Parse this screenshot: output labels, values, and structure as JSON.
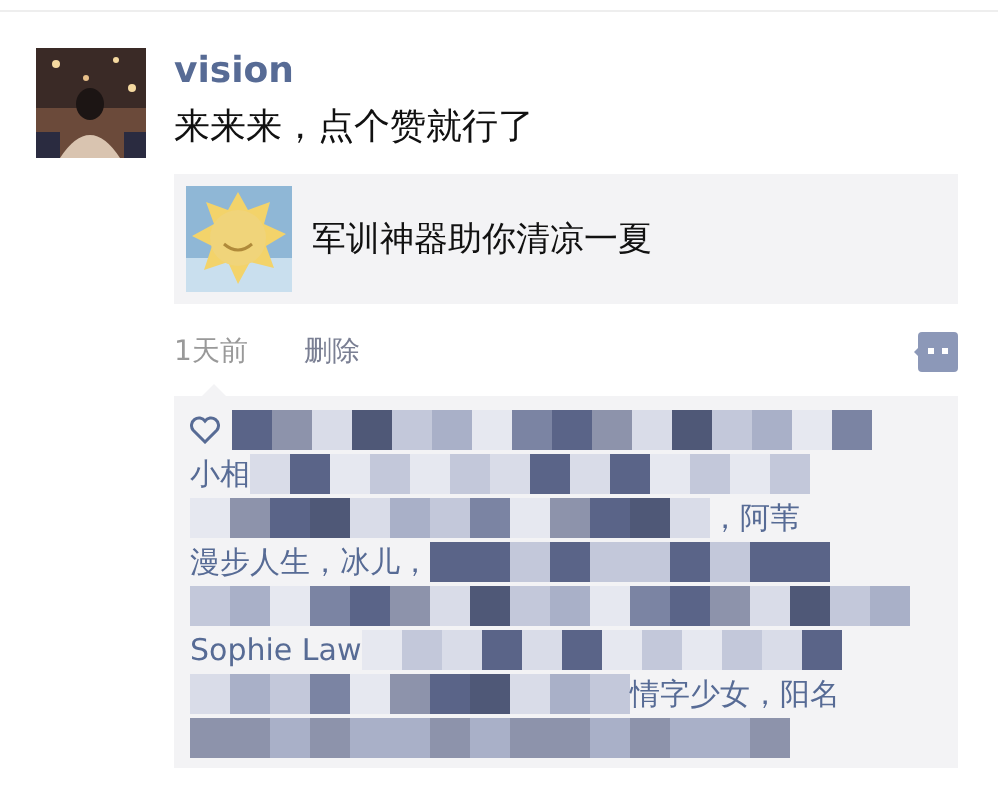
{
  "post": {
    "author": "vision",
    "text": "来来来，点个赞就行了",
    "link": {
      "title": "军训神器助你清凉一夏"
    },
    "time": "1天前",
    "delete": "删除"
  },
  "likes": {
    "rows": [
      [
        {
          "kind": "mosaic"
        }
      ],
      [
        {
          "kind": "text",
          "text": "小相"
        },
        {
          "kind": "mosaic"
        }
      ],
      [
        {
          "kind": "mosaic"
        },
        {
          "kind": "text",
          "text": "，阿苇"
        }
      ],
      [
        {
          "kind": "text",
          "text": "漫步人生，冰儿，"
        },
        {
          "kind": "mosaic"
        }
      ],
      [
        {
          "kind": "mosaic"
        }
      ],
      [
        {
          "kind": "text",
          "text": "Sophie Law"
        },
        {
          "kind": "mosaic"
        }
      ],
      [
        {
          "kind": "mosaic"
        },
        {
          "kind": "text",
          "text": "情字少女，阳名"
        }
      ],
      [
        {
          "kind": "mosaic"
        }
      ]
    ]
  }
}
